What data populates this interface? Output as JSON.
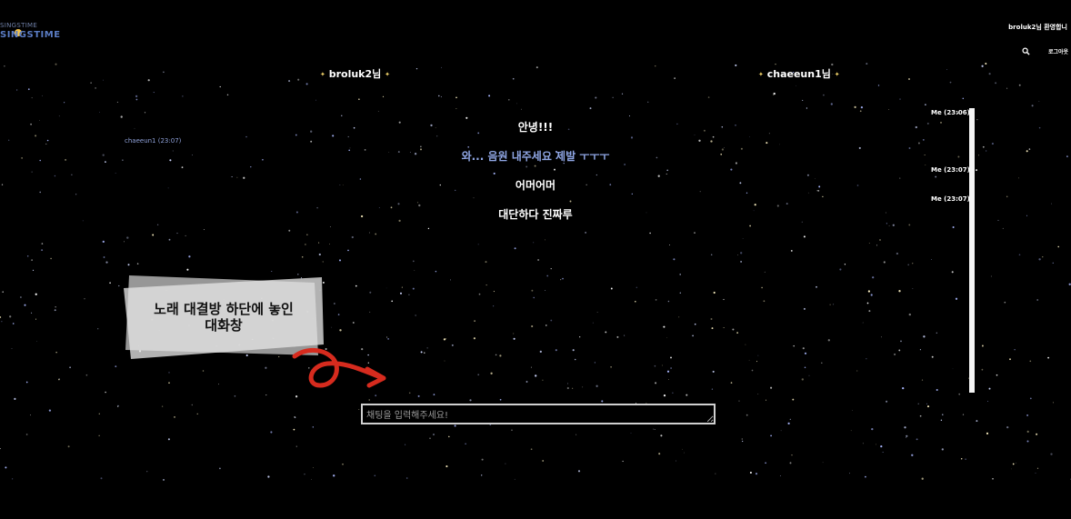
{
  "header": {
    "logo_top": "SINGSTIME",
    "logo_bottom": "SINGSTIME",
    "welcome_text": "broluk2님 환영합니",
    "logout_label": "로그아웃",
    "search_icon": "search-icon"
  },
  "participants": {
    "left_user": "broluk2님",
    "right_user": "chaeeun1님"
  },
  "messages": [
    {
      "text": "안녕!!!",
      "color": "#ffffff"
    },
    {
      "text": "와... 음원 내주세요 제발 ㅜㅜㅜ",
      "color": "#8fa6e4"
    },
    {
      "text": "어머어머",
      "color": "#ffffff"
    },
    {
      "text": "대단하다 진짜루",
      "color": "#ffffff"
    }
  ],
  "timestamps": {
    "left": "chaeeun1 (23:07)",
    "right": [
      "Me (23:06)",
      "Me (23:07)",
      "Me (23:07)"
    ]
  },
  "callout": {
    "line1": "노래 대결방 하단에 놓인",
    "line2": "대화창"
  },
  "chat": {
    "placeholder": "채팅을 입력해주세요!"
  },
  "colors": {
    "background": "#000000",
    "accent_blue": "#8fa6e4",
    "annotation_red": "#d62b1e",
    "star_gold": "#f2d36b"
  }
}
